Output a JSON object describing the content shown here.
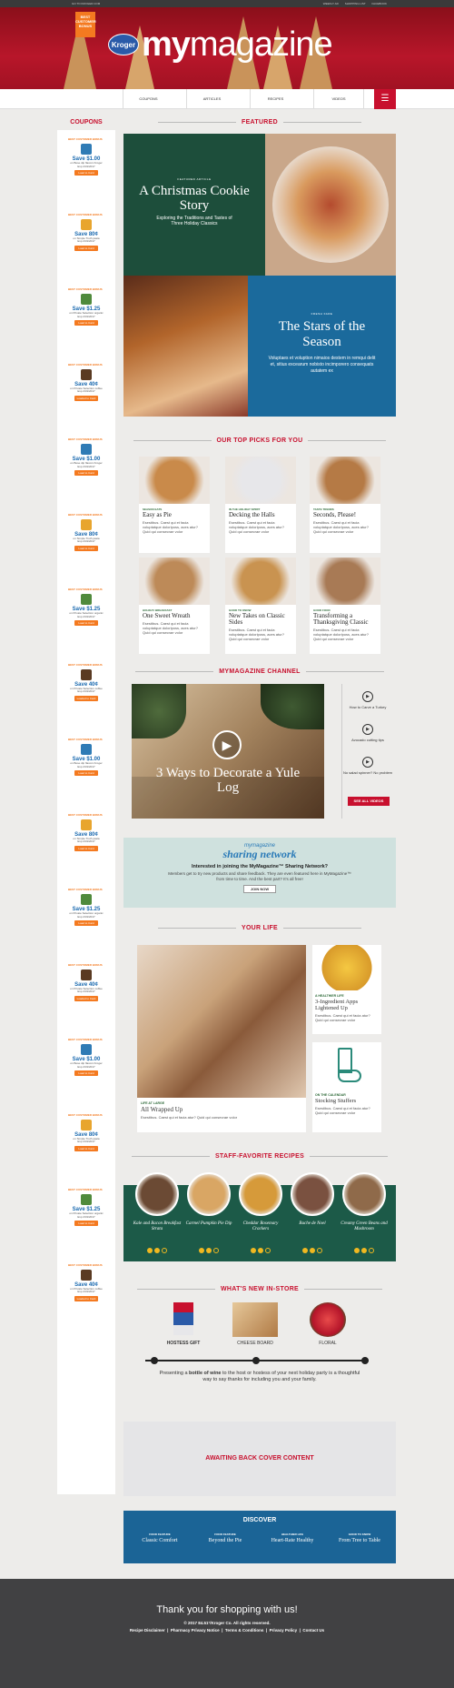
{
  "topbar": {
    "left_link": "GO TO KROGER.COM",
    "right_links": [
      "WEEKLY AD",
      "SHOPPING LIST",
      "FACEBOOK"
    ]
  },
  "header": {
    "badge": "BEST CUSTOMER BONUS",
    "brand": "Kroger",
    "title_bold": "my",
    "title_light": "magazine"
  },
  "nav": {
    "items": [
      "COUPONS",
      "ARTICLES",
      "RECIPES",
      "VIDEOS"
    ],
    "menu_icon": "hamburger-icon"
  },
  "coupons": {
    "title": "COUPONS",
    "items": [
      {
        "best": "BEST CUSTOMER BONUS",
        "save": "Save $1.00",
        "desc": "on Bose dip flavors Kroger",
        "color": "#2f7bb5",
        "load": "Load to Card",
        "exp": "Exp 2/31/2017"
      },
      {
        "best": "BEST CUSTOMER BONUS",
        "save": "Save 80¢",
        "desc": "on Simple Truth pasta",
        "color": "#e8a52e",
        "load": "Load to Card",
        "exp": "Exp 2/31/2017"
      },
      {
        "best": "BEST CUSTOMER BONUS",
        "save": "Save $1.25",
        "desc": "on Private Selection organic",
        "color": "#4f8a3c",
        "load": "Load to Card",
        "exp": "Exp 2/31/2017"
      },
      {
        "best": "BEST CUSTOMER BONUS",
        "save": "Save 40¢",
        "desc": "on Private Selection coffee",
        "color": "#5a3a22",
        "load": "Loaded to Card",
        "exp": "Exp 2/31/2017"
      },
      {
        "best": "BEST CUSTOMER BONUS",
        "save": "Save $1.00",
        "desc": "on Bose dip flavors Kroger",
        "color": "#2f7bb5",
        "load": "Load to Card",
        "exp": "Exp 2/31/2017"
      },
      {
        "best": "BEST CUSTOMER BONUS",
        "save": "Save 80¢",
        "desc": "on Simple Truth pasta",
        "color": "#e8a52e",
        "load": "Load to Card",
        "exp": "Exp 2/31/2017"
      },
      {
        "best": "BEST CUSTOMER BONUS",
        "save": "Save $1.25",
        "desc": "on Private Selection organic",
        "color": "#4f8a3c",
        "load": "Load to Card",
        "exp": "Exp 2/31/2017"
      },
      {
        "best": "BEST CUSTOMER BONUS",
        "save": "Save 40¢",
        "desc": "on Private Selection coffee",
        "color": "#5a3a22",
        "load": "Loaded to Card",
        "exp": "Exp 2/31/2017"
      },
      {
        "best": "BEST CUSTOMER BONUS",
        "save": "Save $1.00",
        "desc": "on Bose dip flavors Kroger",
        "color": "#2f7bb5",
        "load": "Load to Card",
        "exp": "Exp 2/31/2017"
      },
      {
        "best": "BEST CUSTOMER BONUS",
        "save": "Save 80¢",
        "desc": "on Simple Truth pasta",
        "color": "#e8a52e",
        "load": "Load to Card",
        "exp": "Exp 2/31/2017"
      },
      {
        "best": "BEST CUSTOMER BONUS",
        "save": "Save $1.25",
        "desc": "on Private Selection organic",
        "color": "#4f8a3c",
        "load": "Load to Card",
        "exp": "Exp 2/31/2017"
      },
      {
        "best": "BEST CUSTOMER BONUS",
        "save": "Save 40¢",
        "desc": "on Private Selection coffee",
        "color": "#5a3a22",
        "load": "Loaded to Card",
        "exp": "Exp 2/31/2017"
      },
      {
        "best": "BEST CUSTOMER BONUS",
        "save": "Save $1.00",
        "desc": "on Bose dip flavors Kroger",
        "color": "#2f7bb5",
        "load": "Load to Card",
        "exp": "Exp 2/31/2017"
      },
      {
        "best": "BEST CUSTOMER BONUS",
        "save": "Save 80¢",
        "desc": "on Simple Truth pasta",
        "color": "#e8a52e",
        "load": "Load to Card",
        "exp": "Exp 2/31/2017"
      },
      {
        "best": "BEST CUSTOMER BONUS",
        "save": "Save $1.25",
        "desc": "on Private Selection organic",
        "color": "#4f8a3c",
        "load": "Load to Card",
        "exp": "Exp 2/31/2017"
      },
      {
        "best": "BEST CUSTOMER BONUS",
        "save": "Save 40¢",
        "desc": "on Private Selection coffee",
        "color": "#5a3a22",
        "load": "Loaded to Card",
        "exp": "Exp 2/31/2017"
      }
    ]
  },
  "featured": {
    "title": "FEATURED",
    "story1": {
      "kicker": "FEATURED ARTICLE",
      "title": "A Christmas Cookie Story",
      "subtitle": "Exploring the Traditions and Tastes of Three Holiday Classics"
    },
    "story2": {
      "kicker": "FRESH FARE",
      "title": "The Stars of the Season",
      "subtitle": "Voluptaes et voluption nimaios destem in remqui delit et, sitius excearum nobisto incimporero consequats autatem ex"
    }
  },
  "top_picks": {
    "title": "OUR TOP PICKS FOR YOU",
    "cards": [
      {
        "kicker": "SEASON EATS",
        "title": "Easy as Pie",
        "desc": "Esestibus. Caest qui et facia voluptatque doloriposs, aces atur? Quid qui consecrae volor",
        "color": "#c98a4a"
      },
      {
        "kicker": "IN THE HOLIDAY SPIRIT",
        "title": "Decking the Halls",
        "desc": "Esestibus. Caest qui et facia voluptatque doloriposs, aces atur? Quid qui consecrae volor",
        "color": "#e7e7ea"
      },
      {
        "kicker": "TASTE TRENDS",
        "title": "Seconds, Please!",
        "desc": "Esestibus. Caest qui et facia voluptatque doloriposs, aces atur? Quid qui consecrae volor",
        "color": "#b57a45"
      },
      {
        "kicker": "HOLIDAY BREAKFAST",
        "title": "One Sweet Wreath",
        "desc": "Esestibus. Caest qui et facia voluptatque doloriposs, aces atur? Quid qui consecrae volor",
        "color": "#bd8a58"
      },
      {
        "kicker": "GOOD TO KNOW",
        "title": "New Takes on Classic Sides",
        "desc": "Esestibus. Caest qui et facia voluptatque doloriposs, aces atur? Quid qui consecrae volor",
        "color": "#c99350"
      },
      {
        "kicker": "GOOD FOOD",
        "title": "Transforming a Thanksgiving Classic",
        "desc": "Esestibus. Caest qui et facia voluptatque doloriposs, aces atur? Quid qui consecrae volor",
        "color": "#a87a55"
      }
    ]
  },
  "channel": {
    "title": "MYMAGAZINE CHANNEL",
    "video_title": "3 Ways to Decorate a Yule Log",
    "side": [
      "How to Carve a Turkey",
      "Avocado cutting tips",
      "No salad spinner? No problem"
    ],
    "see_all": "SEE ALL VIDEOS"
  },
  "sharing": {
    "logo_top": "mymagazine",
    "logo_bottom": "sharing network",
    "headline": "Interested in joining the MyMagazine™ Sharing Network?",
    "body": "Members get to try new products and share feedback. They are even featured here in MyMagazine™ from time to time. And the best part? It's all free!",
    "button": "JOIN NOW"
  },
  "your_life": {
    "title": "YOUR LIFE",
    "main": {
      "kicker": "LIFE AT LARGE",
      "title": "All Wrapped Up",
      "desc": "Esestibus. Caest qui et facia atur? Quid qui consecrae volor"
    },
    "side1": {
      "kicker": "A HEALTHIER LIFE",
      "title": "3-Ingredient Apps Lightened Up",
      "desc": "Esestibus. Caest qui et facia atur? Quid qui consecrae volor"
    },
    "side2": {
      "kicker": "ON THE CALENDAR",
      "title": "Stocking Stuffers",
      "desc": "Esestibus. Caest qui et facia atur? Quid qui consecrae volor"
    }
  },
  "staff": {
    "title": "STAFF-FAVORITE RECIPES",
    "items": [
      {
        "name": "Kale and Bacon Breakfast Strata",
        "color": "#6b4a34"
      },
      {
        "name": "Carmel Pumpkin Pie Dip",
        "color": "#d9a664"
      },
      {
        "name": "Cheddar Rosemary Crackers",
        "color": "#d69a3a"
      },
      {
        "name": "Buche de Noel",
        "color": "#7a5140"
      },
      {
        "name": "Creamy Green Beans and Mushroom",
        "color": "#8f6a4a"
      }
    ]
  },
  "store": {
    "title": "WHAT'S NEW IN-STORE",
    "items": [
      "HOSTESS GIFT",
      "CHEESE BOARD",
      "FLORAL"
    ],
    "text_pre": "Presenting a ",
    "text_bold": "bottle of wine",
    "text_post": " to the host or hostess of your next holiday party is a thoughtful way to say thanks for including you and your family."
  },
  "back_cover": {
    "text": "AWAITING BACK COVER CONTENT"
  },
  "discover": {
    "title": "DISCOVER",
    "items": [
      {
        "kicker": "FOOD FEATURE",
        "title": "Classic Comfort"
      },
      {
        "kicker": "FOOD FEATURE",
        "title": "Beyond the Pie"
      },
      {
        "kicker": "HEALTHIER LIFE",
        "title": "Heart-Rate Healthy"
      },
      {
        "kicker": "GOOD TO KNOW",
        "title": "From Tree to Table"
      }
    ]
  },
  "footer": {
    "thanks": "Thank you for shopping with us!",
    "copyright": "© 2017 84.51°/Kroger Co. All rights reserved.",
    "links": [
      "Recipe Disclaimer",
      "Pharmacy Privacy Notice",
      "Terms & Conditions",
      "Privacy Policy",
      "Contact Us"
    ]
  }
}
